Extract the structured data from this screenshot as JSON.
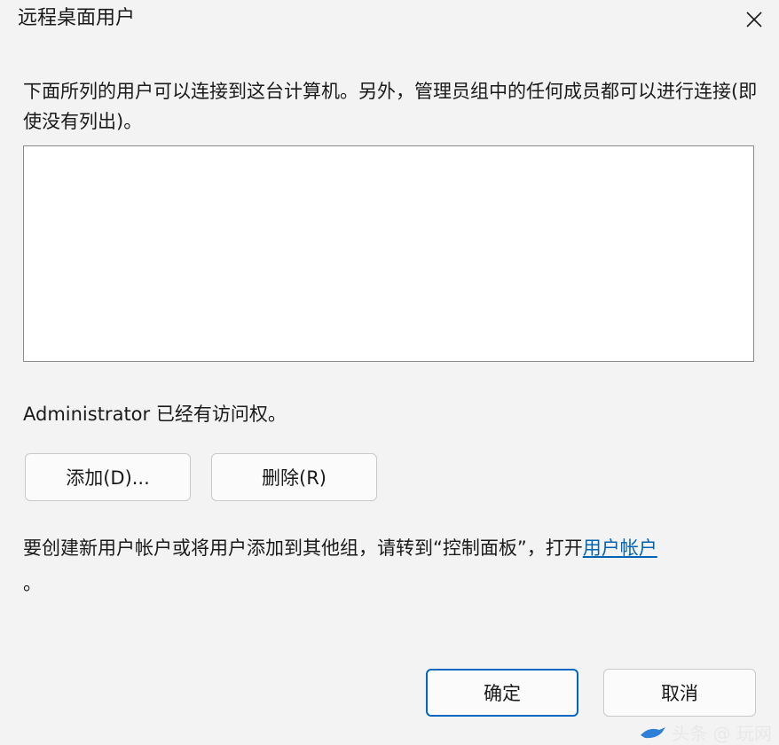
{
  "window": {
    "title": "远程桌面用户"
  },
  "description": "下面所列的用户可以连接到这台计算机。另外，管理员组中的任何成员都可以进行连接(即使没有列出)。",
  "user_list": [],
  "access_note": "Administrator 已经有访问权。",
  "buttons": {
    "add": "添加(D)...",
    "remove": "删除(R)",
    "ok": "确定",
    "cancel": "取消"
  },
  "hint": {
    "text": "要创建新用户帐户或将用户添加到其他组，请转到“控制面板”，打开",
    "link": "用户帐户",
    "tail": "。"
  },
  "watermark": {
    "text": "头条 @ 玩网"
  },
  "colors": {
    "background": "#f3f3f3",
    "accent": "#0067c0",
    "link": "#0063b1"
  }
}
